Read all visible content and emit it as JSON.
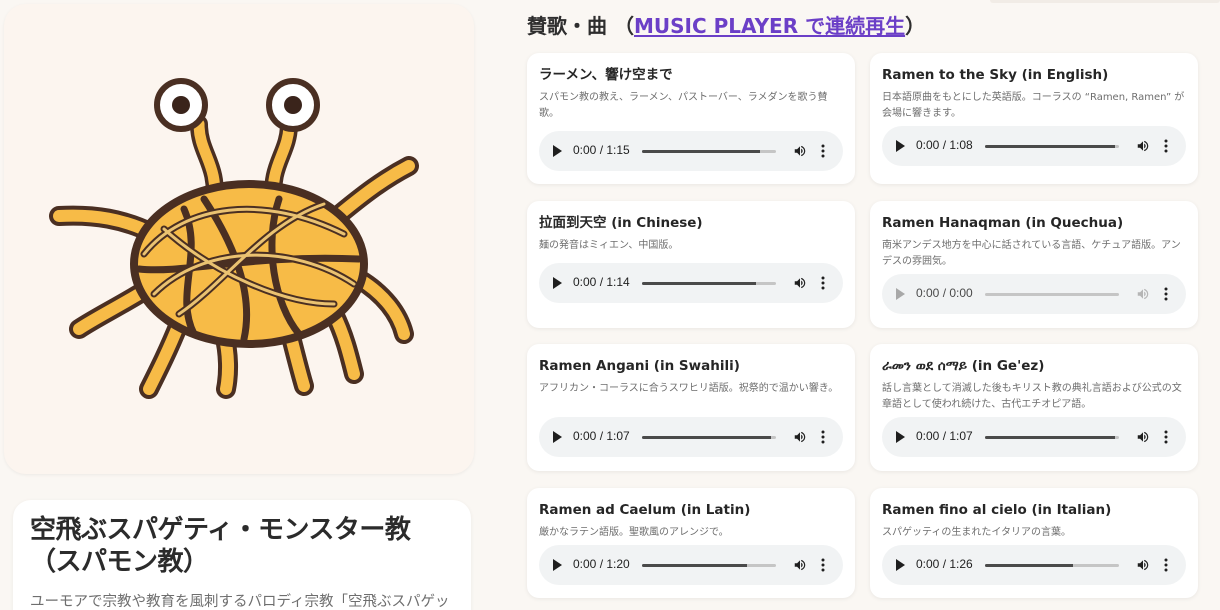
{
  "hero": {
    "image_name": "flying-spaghetti-monster-illustration",
    "colors": {
      "noodle": "#f7bb47",
      "outline": "#4a2f22",
      "background": "#fcf5ef"
    }
  },
  "intro": {
    "title": "空飛ぶスパゲティ・モンスター教（スパモン教）",
    "text": "ユーモアで宗教や教育を風刺するパロディ宗教「空飛ぶスパゲッテ"
  },
  "section": {
    "title_prefix": "賛歌・曲 （",
    "link_label": "MUSIC PLAYER で連続再生",
    "title_suffix": "）"
  },
  "songs": [
    {
      "title": "ラーメン、響け空まで",
      "description": "スパモン教の教え、ラーメン、パストーバー、ラメダンを歌う賛歌。",
      "time": "0:00 / 1:15",
      "progress": 0.88,
      "enabled": true
    },
    {
      "title": "Ramen to the Sky (in English)",
      "description": "日本語原曲をもとにした英語版。コーラスの “Ramen, Ramen” が会場に響きます。",
      "time": "0:00 / 1:08",
      "progress": 0.97,
      "enabled": true
    },
    {
      "title": "拉面到天空 (in Chinese)",
      "description": "麺の発音はミィエン、中国版。",
      "time": "0:00 / 1:14",
      "progress": 0.85,
      "enabled": true
    },
    {
      "title": "Ramen Hanaqman (in Quechua)",
      "description": "南米アンデス地方を中心に話されている言語、ケチュア語版。アンデスの雰囲気。",
      "time": "0:00 / 0:00",
      "progress": 0,
      "enabled": false
    },
    {
      "title": "Ramen Angani (in Swahili)",
      "description": "アフリカン・コーラスに合うスワヒリ語版。祝祭的で温かい響き。",
      "time": "0:00 / 1:07",
      "progress": 0.96,
      "enabled": true
    },
    {
      "title": "ራመን ወደ ሰማይ (in Ge'ez)",
      "description": "話し言葉として消滅した後もキリスト教の典礼言語および公式の文章語として使われ続けた、古代エチオピア語。",
      "time": "0:00 / 1:07",
      "progress": 0.97,
      "enabled": true
    },
    {
      "title": "Ramen ad Caelum (in Latin)",
      "description": "厳かなラテン語版。聖歌風のアレンジで。",
      "time": "0:00 / 1:20",
      "progress": 0.78,
      "enabled": true
    },
    {
      "title": "Ramen fino al cielo (in Italian)",
      "description": "スパゲッティの生まれたイタリアの言葉。",
      "time": "0:00 / 1:26",
      "progress": 0.66,
      "enabled": true
    }
  ],
  "icons": {
    "play": "play-icon",
    "volume": "volume-icon",
    "more": "more-vertical-icon"
  }
}
